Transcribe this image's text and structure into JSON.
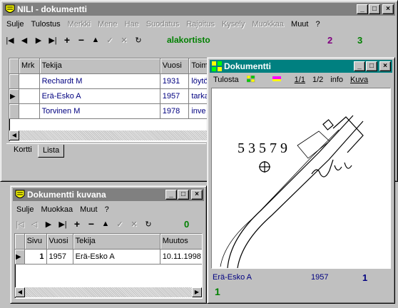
{
  "main": {
    "title": "NILI - dokumentti",
    "menu": [
      {
        "label": "Sulje",
        "disabled": false
      },
      {
        "label": "Tulostus",
        "disabled": false
      },
      {
        "label": "Merkki",
        "disabled": true
      },
      {
        "label": "Mene",
        "disabled": true
      },
      {
        "label": "Hae",
        "disabled": true
      },
      {
        "label": "Suodatus",
        "disabled": true
      },
      {
        "label": "Rajoitus",
        "disabled": true
      },
      {
        "label": "Kysely",
        "disabled": true
      },
      {
        "label": "Muokkaa",
        "disabled": true
      },
      {
        "label": "Muut",
        "disabled": false
      },
      {
        "label": "?",
        "disabled": false
      }
    ],
    "num_a": "2",
    "num_b": "3",
    "context_label": "alakortisto",
    "columns": [
      "Mrk",
      "Tekija",
      "Vuosi",
      "Toim"
    ],
    "rows": [
      {
        "mrk": "",
        "tekija": "Rechardt M",
        "vuosi": "1931",
        "toim": "löytö"
      },
      {
        "mrk": "",
        "tekija": "Erä-Esko A",
        "vuosi": "1957",
        "toim": "tarka"
      },
      {
        "mrk": "",
        "tekija": "Torvinen M",
        "vuosi": "1978",
        "toim": "inve"
      }
    ],
    "tabs": [
      "Kortti",
      "Lista"
    ]
  },
  "kuvana": {
    "title": "Dokumentti kuvana",
    "menu": [
      "Sulje",
      "Muokkaa",
      "Muut",
      "?"
    ],
    "count": "0",
    "columns": [
      "Sivu",
      "Vuosi",
      "Tekija",
      "Muutos"
    ],
    "rows": [
      {
        "sivu": "1",
        "vuosi": "1957",
        "tekija": "Erä-Esko A",
        "muutos": "10.11.1998"
      }
    ]
  },
  "doc": {
    "title": "Dokumentti",
    "menu": {
      "tulosta": "Tulosta",
      "page1": "1/1",
      "page2": "1/2",
      "info": "info",
      "kuva": "Kuva"
    },
    "sketch_label": "5 3 5 7 9",
    "status_name": "Erä-Esko A",
    "status_year": "1957",
    "status_num": "1",
    "bottom_num": "1"
  },
  "colors": {
    "navy": "#000080",
    "green": "#008000",
    "purple": "#800080",
    "teal": "#008080"
  }
}
